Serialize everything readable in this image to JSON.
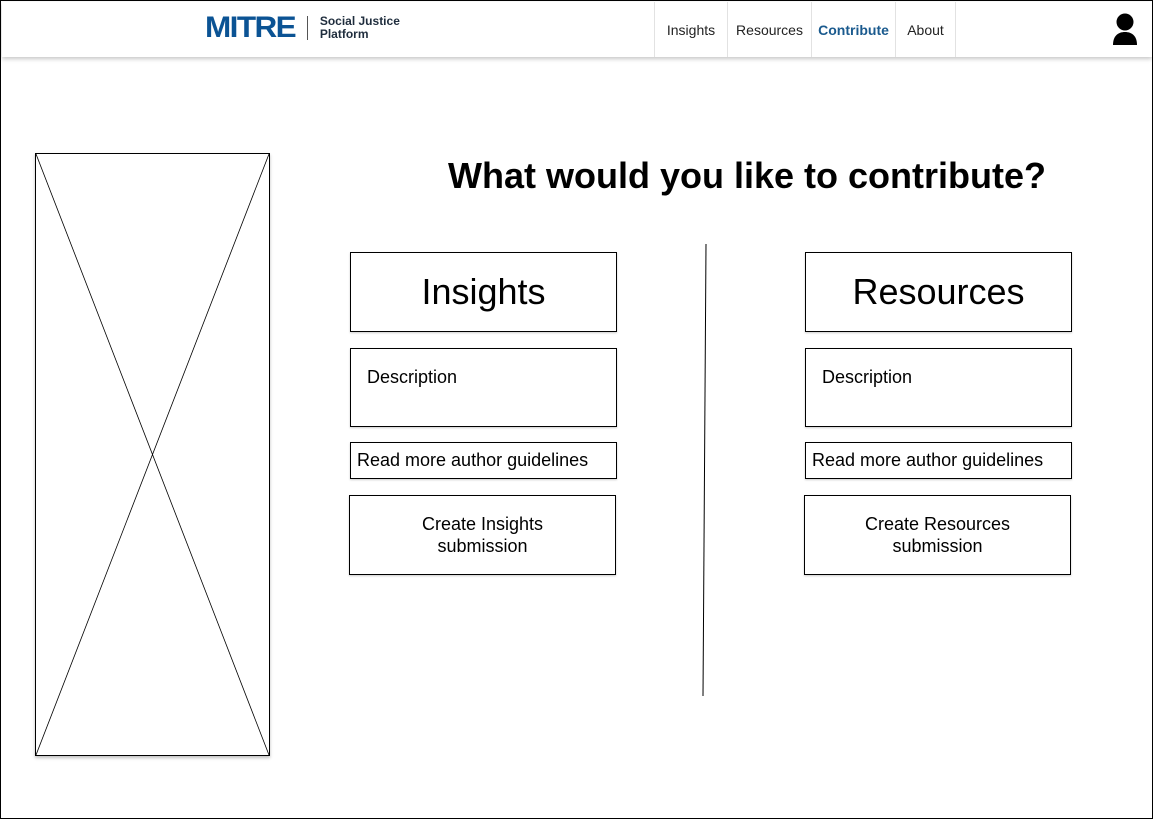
{
  "header": {
    "logo_mark": "MITRE",
    "logo_sub_line1": "Social Justice",
    "logo_sub_line2": "Platform",
    "nav": [
      {
        "label": "Insights"
      },
      {
        "label": "Resources"
      },
      {
        "label": "Contribute"
      },
      {
        "label": "About"
      }
    ],
    "active_nav": "Contribute",
    "user_icon": "user-icon",
    "brand_color": "#0b5394"
  },
  "main": {
    "heading": "What would you like to contribute?",
    "image_placeholder_icon": "image-placeholder-icon",
    "columns": [
      {
        "title": "Insights",
        "description": "Description",
        "guidelines_link": "Read more author guidelines",
        "create_button": "Create Insights submission"
      },
      {
        "title": "Resources",
        "description": "Description",
        "guidelines_link": "Read more author guidelines",
        "create_button": "Create Resources submission"
      }
    ]
  }
}
